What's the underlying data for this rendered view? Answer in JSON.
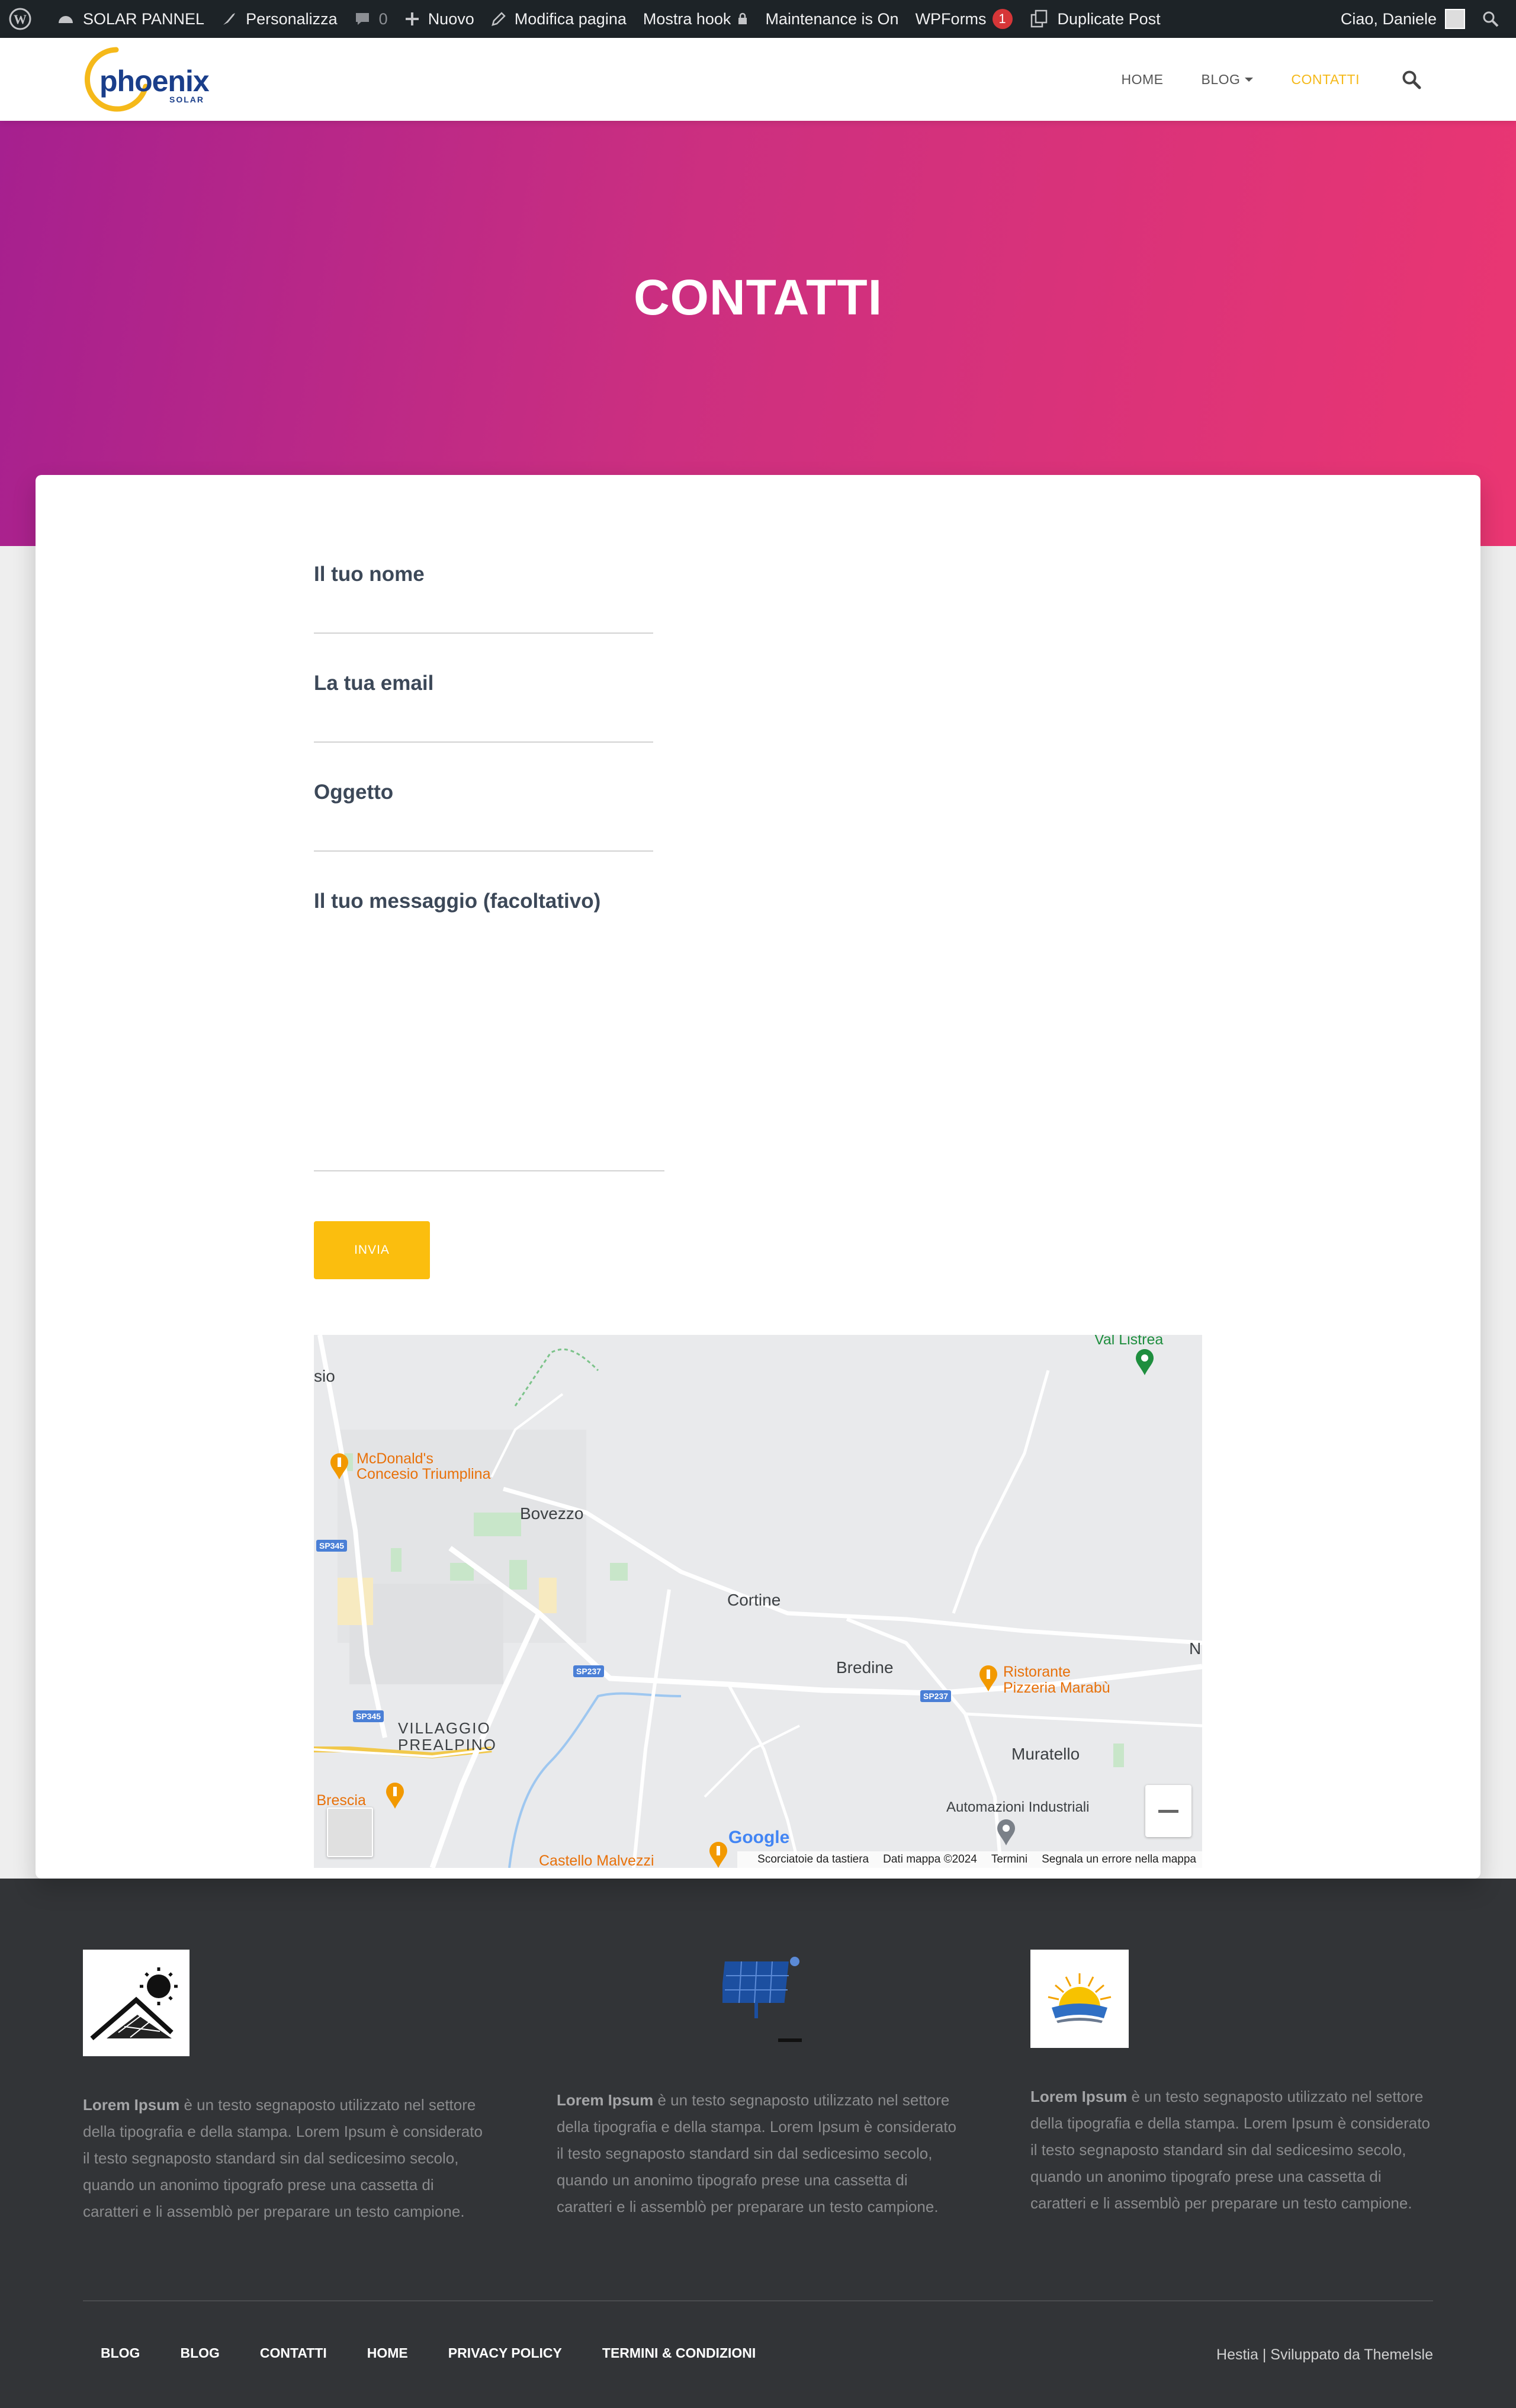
{
  "admin_bar": {
    "site_name": "SOLAR PANNEL",
    "customize": "Personalizza",
    "comments_count": "0",
    "new": "Nuovo",
    "edit_page": "Modifica pagina",
    "show_hook": "Mostra hook",
    "maintenance": "Maintenance is On",
    "wpforms": "WPForms",
    "wpforms_badge": "1",
    "duplicate": "Duplicate Post",
    "greeting": "Ciao, Daniele"
  },
  "navbar": {
    "logo_word": "phoenix",
    "logo_sub": "SOLAR",
    "items": [
      {
        "label": "HOME"
      },
      {
        "label": "BLOG"
      },
      {
        "label": "CONTATTI"
      }
    ]
  },
  "hero": {
    "title": "CONTATTI"
  },
  "form": {
    "name_label": "Il tuo nome",
    "email_label": "La tua email",
    "subject_label": "Oggetto",
    "message_label": "Il tuo messaggio (facoltativo)",
    "submit_label": "INVIA"
  },
  "map": {
    "labels": {
      "sio": "sio",
      "val_listrea": "Val Listrea",
      "mcdonalds": "McDonald's\nConcesio Triumplina",
      "bovezzo": "Bovezzo",
      "cortine": "Cortine",
      "bredine": "Bredine",
      "ristorante": "Ristorante\nPizzeria Marabù",
      "n": "N",
      "villaggio": "VILLAGGIO\nPREALPINO",
      "muratello": "Muratello",
      "automazioni": "Automazioni Industriali",
      "brescia": "i Brescia",
      "castello": "Castello Malvezzi"
    },
    "road_signs": [
      "SP345",
      "SP237",
      "SP345",
      "SP237"
    ],
    "google": "Google",
    "attribution": {
      "shortcuts": "Scorciatoie da tastiera",
      "data": "Dati mappa ©2024",
      "terms": "Termini",
      "report": "Segnala un errore nella mappa"
    }
  },
  "footer": {
    "columns": [
      {
        "bold": "Lorem Ipsum",
        "text": " è un testo segnaposto utilizzato nel settore della tipografia e della stampa. Lorem Ipsum è considerato il testo segnaposto standard sin dal sedicesimo secolo, quando un anonimo tipografo prese una cassetta di caratteri e li assemblò per preparare un testo campione."
      },
      {
        "bold": "Lorem Ipsum",
        "text": " è un testo segnaposto utilizzato nel settore della tipografia e della stampa. Lorem Ipsum è considerato il testo segnaposto standard sin dal sedicesimo secolo, quando un anonimo tipografo prese una cassetta di caratteri e li assemblò per preparare un testo campione."
      },
      {
        "bold": "Lorem Ipsum",
        "text": " è un testo segnaposto utilizzato nel settore della tipografia e della stampa. Lorem Ipsum è considerato il testo segnaposto standard sin dal sedicesimo secolo, quando un anonimo tipografo prese una cassetta di caratteri e li assemblò per preparare un testo campione."
      }
    ],
    "menu": [
      "BLOG",
      "BLOG",
      "CONTATTI",
      "HOME",
      "PRIVACY POLICY",
      "TERMINI & CONDIZIONI"
    ],
    "credit": "Hestia | Sviluppato da ThemeIsle"
  },
  "colors": {
    "accent": "#fbbe0e",
    "hero_start": "#a6208f",
    "hero_end": "#ea3672",
    "footer_bg": "#323437",
    "admin_bar": "#1d2327"
  }
}
